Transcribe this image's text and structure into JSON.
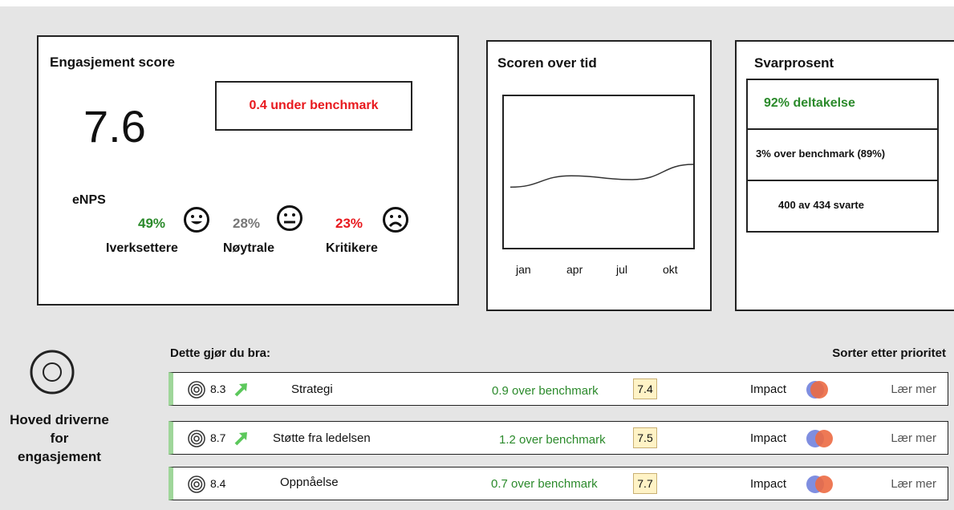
{
  "engagement": {
    "title": "Engasjement score",
    "score": "7.6",
    "benchmark_text": "0.4 under benchmark",
    "enps_label": "eNPS",
    "enps": [
      {
        "pct": "49%",
        "label": "Iverksettere",
        "color": "#2b8a2b",
        "mood": "happy-face-icon"
      },
      {
        "pct": "28%",
        "label": "Nøytrale",
        "color": "#777777",
        "mood": "neutral-face-icon"
      },
      {
        "pct": "23%",
        "label": "Kritikere",
        "color": "#e8191e",
        "mood": "sad-face-icon"
      }
    ]
  },
  "time_panel": {
    "title": "Scoren over tid",
    "months": [
      "jan",
      "apr",
      "jul",
      "okt"
    ]
  },
  "chart_data": {
    "type": "line",
    "title": "",
    "xlabel": "",
    "ylabel": "",
    "x": [
      "jan",
      "apr",
      "jul",
      "okt"
    ],
    "series": [
      {
        "values": [
          7.3,
          7.45,
          7.4,
          7.6
        ]
      }
    ],
    "ylim": [
      6.5,
      8.5
    ],
    "grid": false
  },
  "response": {
    "title": "Svarprosent",
    "participation": "92% deltakelse",
    "over_benchmark": "3% over benchmark (89%)",
    "answered": "400 av 434 svarte"
  },
  "drivers": {
    "side_label": "Hoved driverne for engasjement",
    "section_title": "Dette gjør du bra:",
    "sort_label": "Sorter etter prioritet",
    "rows": [
      {
        "score": "8.3",
        "name": "Strategi",
        "bench": "0.9 over benchmark",
        "badge": "7.4",
        "impact": "Impact",
        "learn": "Lær mer",
        "arrow": true,
        "overlap": 0.75
      },
      {
        "score": "8.7",
        "name": "Støtte fra ledelsen",
        "bench": "1.2 over benchmark",
        "badge": "7.5",
        "impact": "Impact",
        "learn": "Lær mer",
        "arrow": true,
        "overlap": 0.45
      },
      {
        "score": "8.4",
        "name": "Oppnåelse",
        "bench": "0.7 over benchmark",
        "badge": "7.7",
        "impact": "Impact",
        "learn": "Lær mer",
        "arrow": false,
        "overlap": 0.45
      }
    ]
  },
  "colors": {
    "positive": "#2b8a2b",
    "negative": "#e8191e",
    "arrow": "#5cc85c",
    "badge_bg": "#fff3c6",
    "impact_blue": "#7f8ee0",
    "impact_orange": "#ec6a42"
  }
}
